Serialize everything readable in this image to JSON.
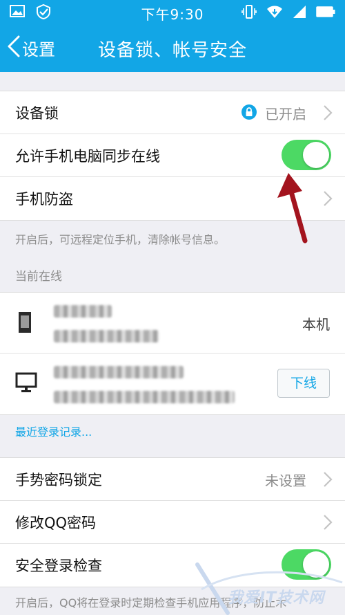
{
  "status_bar": {
    "time": "下午9:30"
  },
  "nav": {
    "back_label": "设置",
    "title": "设备锁、帐号安全"
  },
  "security": {
    "device_lock": {
      "label": "设备锁",
      "value": "已开启"
    },
    "sync_online": {
      "label": "允许手机电脑同步在线",
      "enabled": true
    },
    "anti_theft": {
      "label": "手机防盗"
    }
  },
  "anti_theft_note": "开启后，可远程定位手机，清除帐号信息。",
  "online_section": {
    "title": "当前在线",
    "devices": [
      {
        "type": "phone",
        "tag": "本机"
      },
      {
        "type": "computer",
        "action": "下线"
      }
    ]
  },
  "recent_login_link": "最近登录记录...",
  "settings": {
    "gesture_lock": {
      "label": "手势密码锁定",
      "value": "未设置"
    },
    "change_password": {
      "label": "修改QQ密码"
    },
    "login_check": {
      "label": "安全登录检查",
      "enabled": true
    }
  },
  "login_check_note": "开启后，QQ将在登录时定期检查手机应用程序，防止木",
  "watermark": {
    "text": "我爱IT技术网"
  },
  "colors": {
    "primary": "#12a6e6",
    "toggle_on": "#4cd964",
    "arrow": "#a3141e"
  }
}
